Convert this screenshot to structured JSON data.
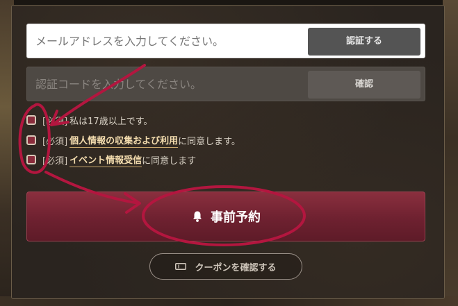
{
  "email": {
    "placeholder": "メールアドレスを入力してください。",
    "verify_label": "認証する"
  },
  "code": {
    "placeholder": "認証コードを入力してください。",
    "confirm_label": "確認"
  },
  "agreements": [
    {
      "prefix": "[必須]",
      "text": "私は17歳以上です。",
      "link": "",
      "suffix": ""
    },
    {
      "prefix": "[必須]",
      "text": "",
      "link": "個人情報の収集および利用",
      "suffix": "に同意します。"
    },
    {
      "prefix": "[必須]",
      "text": "",
      "link": "イベント情報受信",
      "suffix": "に同意します"
    }
  ],
  "reserve": {
    "label": "事前予約",
    "icon": "bell-icon"
  },
  "coupon": {
    "label": "クーポンを確認する",
    "icon": "ticket-icon"
  },
  "colors": {
    "accent": "#7a2636",
    "annotation": "#b3163f",
    "checkbox": "#8a2d3c",
    "panel": "#2a241f"
  }
}
